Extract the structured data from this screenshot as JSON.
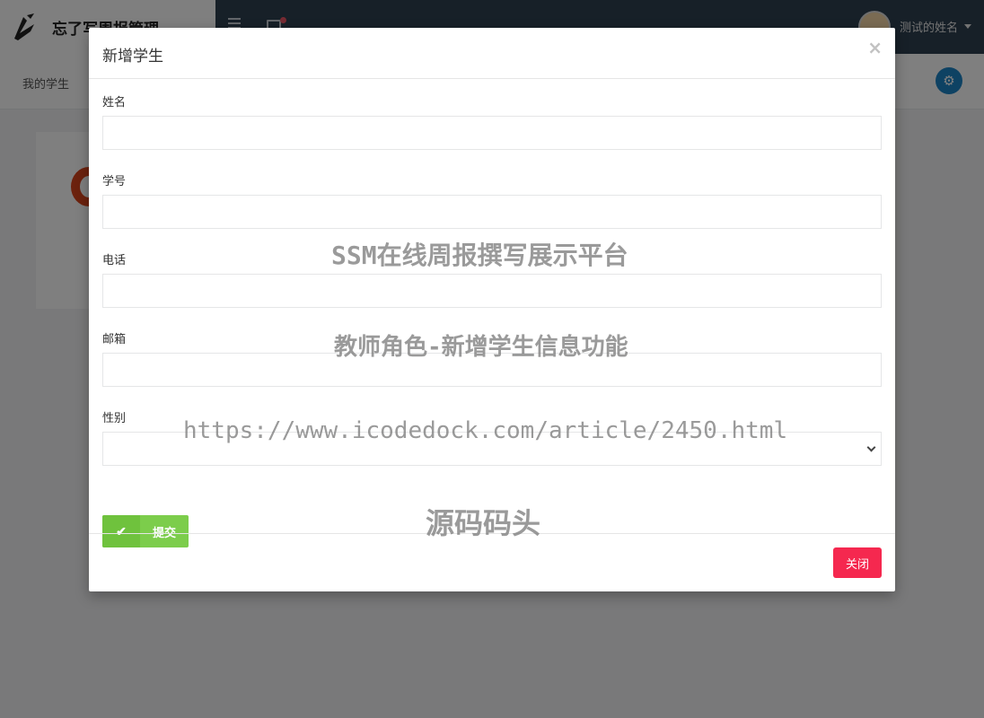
{
  "app": {
    "brand_title": "忘了写周报管理",
    "user_name": "测试的姓名",
    "subbar_tab": "我的学生"
  },
  "icons": {
    "brand": "logo-icon",
    "menu": "hamburger-icon",
    "mail": "mail-icon",
    "settings": "gear-icon",
    "check": "check-icon",
    "close": "close-icon"
  },
  "modal": {
    "title": "新增学生",
    "close_glyph": "×",
    "fields": {
      "name": {
        "label": "姓名",
        "value": "",
        "placeholder": ""
      },
      "student_no": {
        "label": "学号",
        "value": "",
        "placeholder": ""
      },
      "phone": {
        "label": "电话",
        "value": "",
        "placeholder": ""
      },
      "email": {
        "label": "邮箱",
        "value": "",
        "placeholder": ""
      },
      "gender": {
        "label": "性别",
        "selected": ""
      }
    },
    "submit_label": "提交",
    "footer_close_label": "关闭"
  },
  "watermark": {
    "line1": "SSM在线周报撰写展示平台",
    "line2": "教师角色-新增学生信息功能",
    "line3": "https://www.icodedock.com/article/2450.html",
    "line4": "源码码头"
  },
  "colors": {
    "topbar": "#2f4050",
    "submit": "#7ccd4b",
    "close_button": "#f5284f",
    "settings_button": "#1c84c6",
    "mail_badge": "#ed5565"
  }
}
